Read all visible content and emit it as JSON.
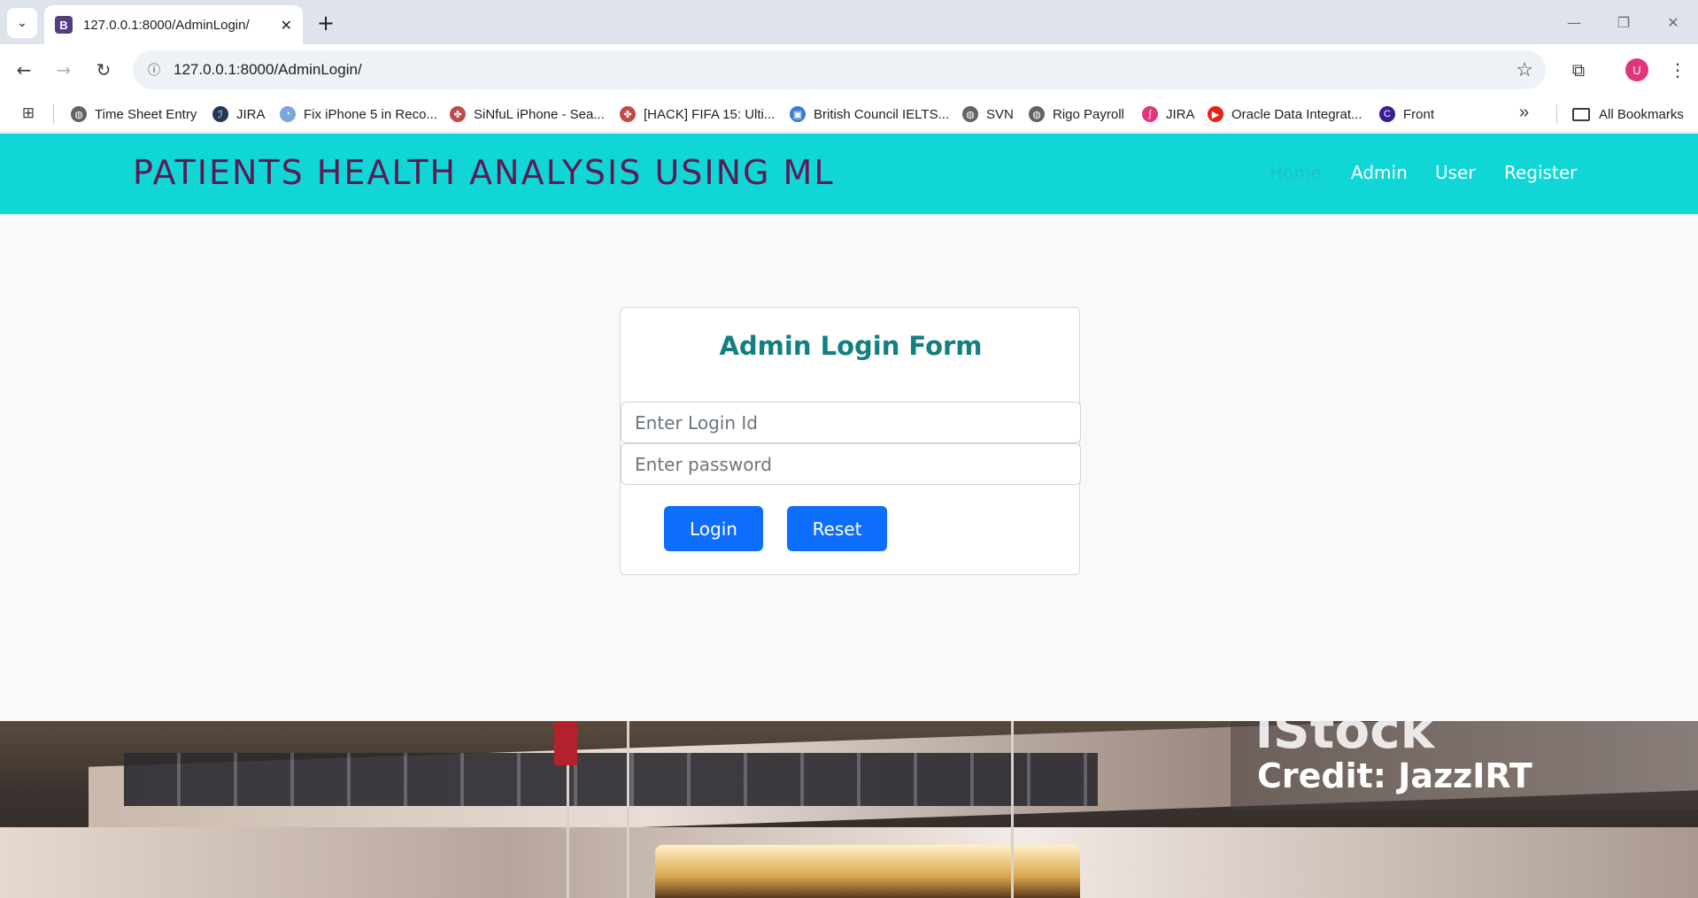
{
  "browser": {
    "tab_title": "127.0.0.1:8000/AdminLogin/",
    "tab_favicon_letter": "B",
    "url": "127.0.0.1:8000/AdminLogin/",
    "profile_initial": "U",
    "bookmarks": [
      {
        "label": "Time Sheet Entry",
        "icon": "globe-icon",
        "color": "#5f6368"
      },
      {
        "label": "JIRA",
        "icon": "jira-icon",
        "color": "#253858"
      },
      {
        "label": "Fix iPhone 5 in Reco...",
        "icon": "drop-icon",
        "color": "#7aa7d9"
      },
      {
        "label": "SiNfuL iPhone - Sea...",
        "icon": "pinwheel-icon",
        "color": "#c04a4a"
      },
      {
        "label": "[HACK] FIFA 15: Ulti...",
        "icon": "pinwheel-icon",
        "color": "#c04a4a"
      },
      {
        "label": "British Council IELTS...",
        "icon": "ors-icon",
        "color": "#3a7bd5"
      },
      {
        "label": "SVN",
        "icon": "globe-icon",
        "color": "#5f6368"
      },
      {
        "label": "Rigo Payroll",
        "icon": "globe-icon",
        "color": "#5f6368"
      },
      {
        "label": "JIRA",
        "icon": "curve-icon",
        "color": "#e0357b"
      },
      {
        "label": "Oracle Data Integrat...",
        "icon": "youtube-icon",
        "color": "#e62117"
      },
      {
        "label": "Front",
        "icon": "front-icon",
        "color": "#3b1d8f"
      }
    ],
    "all_bookmarks": "All Bookmarks"
  },
  "header": {
    "brand": "PATIENTS HEALTH ANALYSIS USING ML",
    "nav": [
      "Home",
      "Admin",
      "User",
      "Register"
    ],
    "active_nav": "Home"
  },
  "login_form": {
    "title": "Admin Login Form",
    "login_id_placeholder": "Enter Login Id",
    "login_id_value": "",
    "password_placeholder": "Enter password",
    "password_value": "",
    "login_label": "Login",
    "reset_label": "Reset"
  },
  "hero": {
    "watermark_brand": "iStock",
    "watermark_credit": "Credit: JazzIRT"
  },
  "colors": {
    "header_bg": "#10d7d6",
    "brand_text": "#5c1b55",
    "form_title": "#128080",
    "button": "#0d6efd"
  }
}
